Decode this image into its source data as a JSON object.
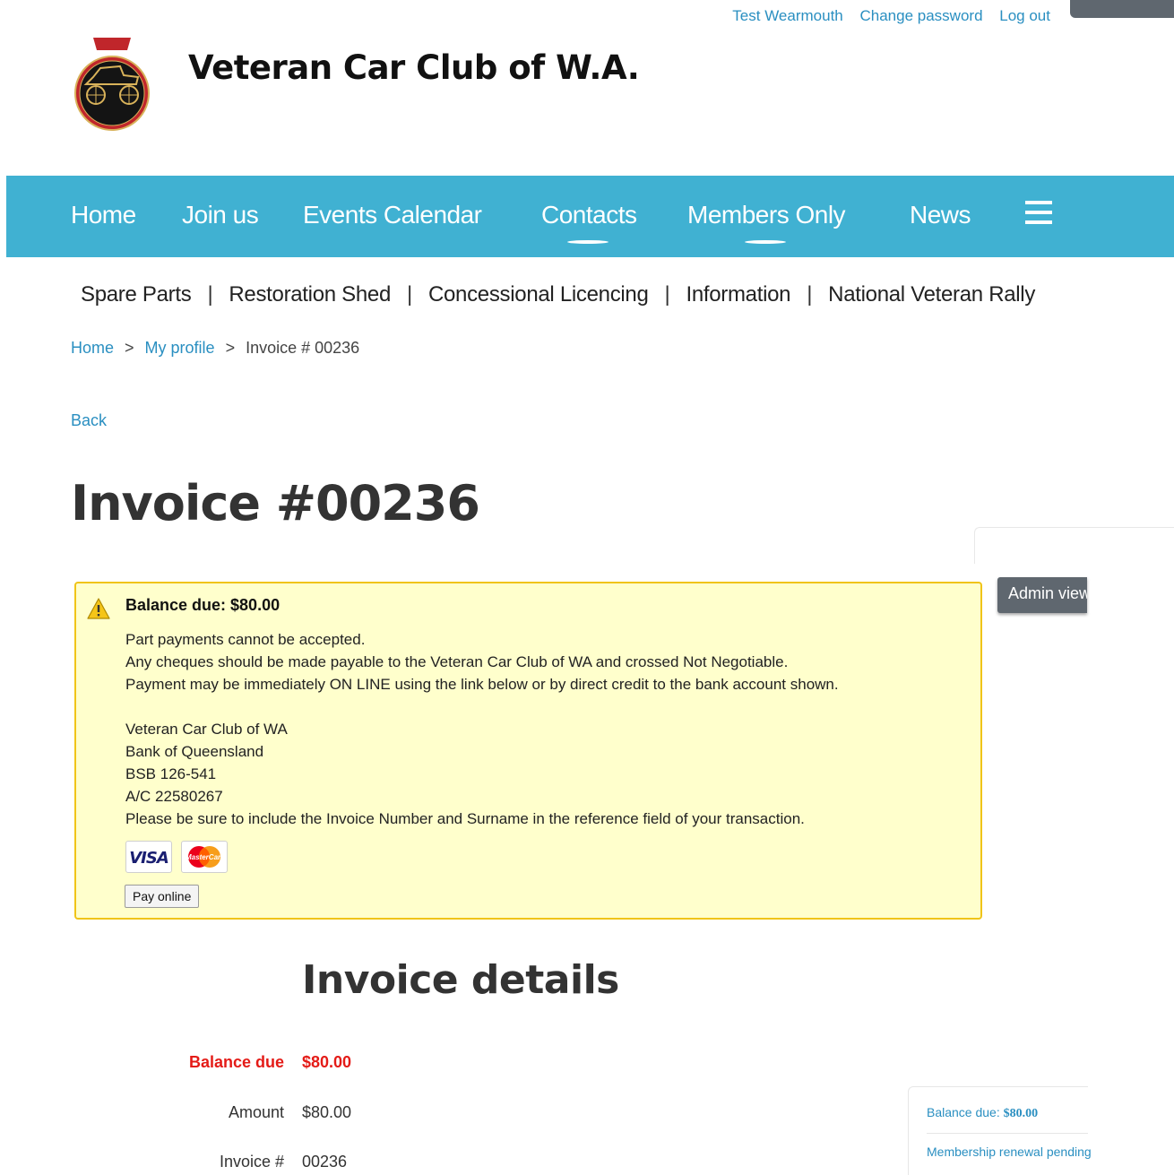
{
  "user_bar": {
    "user_name": "Test Wearmouth",
    "change_password": "Change password",
    "log_out": "Log out"
  },
  "site": {
    "title": "Veteran Car Club of W.A."
  },
  "main_nav": [
    {
      "label": "Home"
    },
    {
      "label": "Join us"
    },
    {
      "label": "Events Calendar"
    },
    {
      "label": "Contacts"
    },
    {
      "label": "Members Only"
    },
    {
      "label": "News"
    }
  ],
  "sub_nav": [
    {
      "label": "Spare Parts"
    },
    {
      "label": "Restoration Shed"
    },
    {
      "label": "Concessional Licencing"
    },
    {
      "label": "Information"
    },
    {
      "label": "National Veteran Rally"
    }
  ],
  "breadcrumb": {
    "home": "Home",
    "profile": "My profile",
    "current": "Invoice # 00236",
    "separator": ">"
  },
  "back_label": "Back",
  "page_title": "Invoice #00236",
  "admin_view_label": "Admin view",
  "notice": {
    "heading": "Balance due: $80.00",
    "lines": [
      "Part payments cannot be accepted.",
      "Any cheques should be made payable to the Veteran Car Club of WA and crossed Not Negotiable.",
      "Payment may be immediately ON LINE using the link below or by direct credit to the bank account shown.",
      "",
      "Veteran Car Club of WA",
      "Bank of Queensland",
      "BSB 126-541",
      "A/C 22580267",
      "Please be sure to include the Invoice Number and Surname in the reference field of your transaction."
    ],
    "cards": {
      "visa": "VISA",
      "mastercard": "MasterCard"
    },
    "pay_button": "Pay online"
  },
  "details": {
    "title": "Invoice details",
    "balance_label": "Balance due",
    "balance_value": "$80.00",
    "amount_label": "Amount",
    "amount_value": "$80.00",
    "invoice_label": "Invoice #",
    "invoice_value": "00236"
  },
  "summary": {
    "balance_label": "Balance due: ",
    "balance_value": "$80.00",
    "status": "Membership renewal pending"
  },
  "colors": {
    "nav_bg": "#40b1d2",
    "link": "#2a8fc1",
    "notice_bg": "#ffffcc",
    "notice_border": "#f0c419",
    "balance_red": "#e41b17"
  }
}
